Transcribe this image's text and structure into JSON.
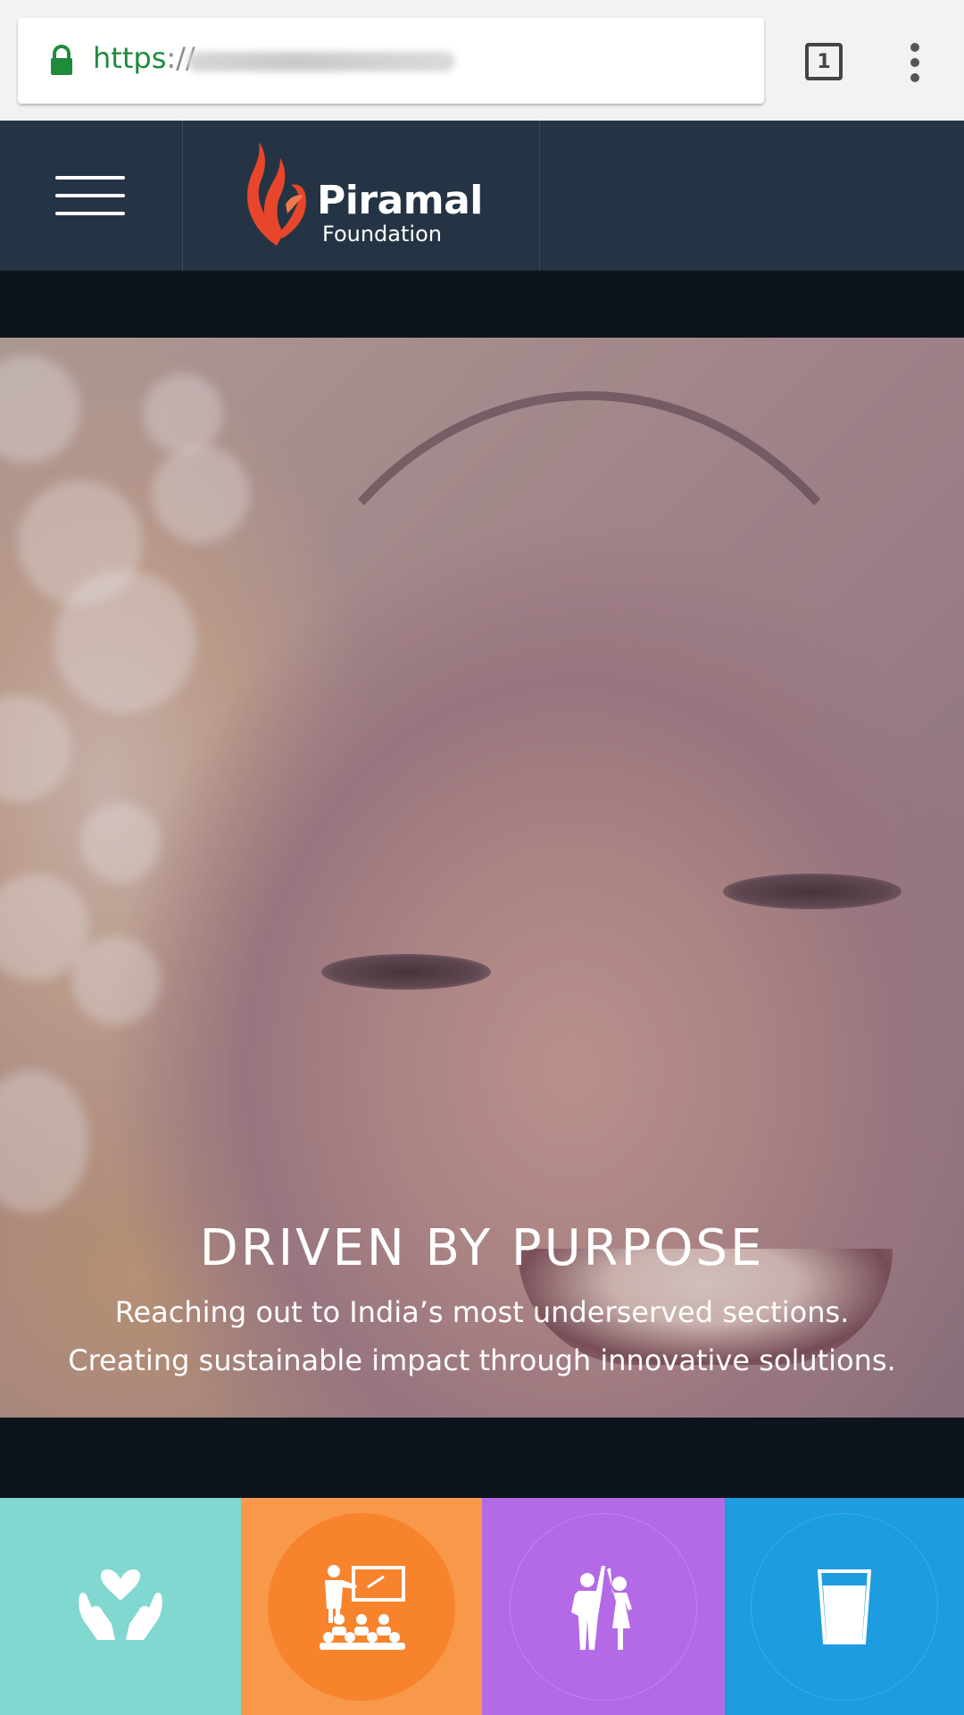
{
  "browser": {
    "url_scheme": "https",
    "url_separator": "://",
    "tab_count": "1",
    "icons": {
      "lock": "lock-icon",
      "tabs": "tab-switcher-icon",
      "menu": "more-vert-icon"
    }
  },
  "header": {
    "menu_icon": "hamburger-icon",
    "logo": {
      "name": "Piramal",
      "subtitle": "Foundation",
      "mark_color": "#e8462a"
    },
    "background": "#243444"
  },
  "hero": {
    "title": "DRIVEN BY PURPOSE",
    "lines": [
      "Reaching out to India’s most underserved sections.",
      "Creating sustainable impact through innovative solutions."
    ]
  },
  "tiles": [
    {
      "icon": "caring-hands-heart-icon",
      "color": "#80d8d0"
    },
    {
      "icon": "classroom-teacher-icon",
      "color": "#f8984a",
      "ring_color": "#f7832c"
    },
    {
      "icon": "children-high-five-icon",
      "color": "#b46ae6"
    },
    {
      "icon": "water-glass-icon",
      "color": "#1e9ce0"
    }
  ]
}
